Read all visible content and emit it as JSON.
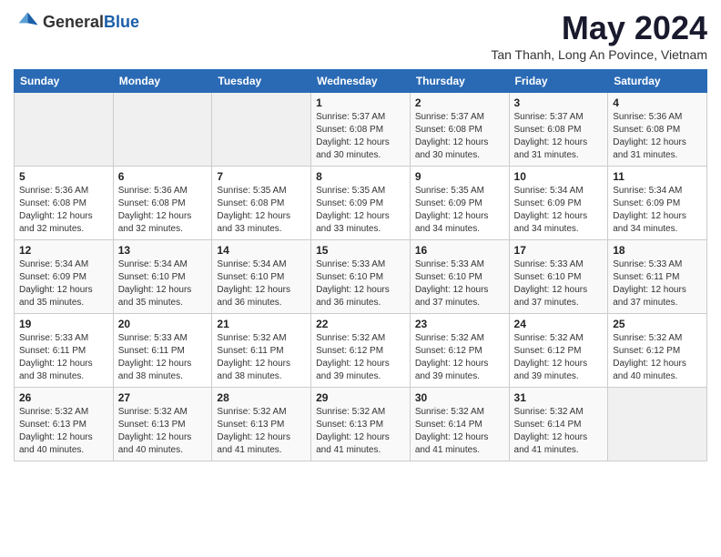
{
  "header": {
    "logo_general": "General",
    "logo_blue": "Blue",
    "main_title": "May 2024",
    "subtitle": "Tan Thanh, Long An Povince, Vietnam"
  },
  "calendar": {
    "weekdays": [
      "Sunday",
      "Monday",
      "Tuesday",
      "Wednesday",
      "Thursday",
      "Friday",
      "Saturday"
    ],
    "weeks": [
      [
        {
          "day": "",
          "sunrise": "",
          "sunset": "",
          "daylight": ""
        },
        {
          "day": "",
          "sunrise": "",
          "sunset": "",
          "daylight": ""
        },
        {
          "day": "",
          "sunrise": "",
          "sunset": "",
          "daylight": ""
        },
        {
          "day": "1",
          "sunrise": "Sunrise: 5:37 AM",
          "sunset": "Sunset: 6:08 PM",
          "daylight": "Daylight: 12 hours and 30 minutes."
        },
        {
          "day": "2",
          "sunrise": "Sunrise: 5:37 AM",
          "sunset": "Sunset: 6:08 PM",
          "daylight": "Daylight: 12 hours and 30 minutes."
        },
        {
          "day": "3",
          "sunrise": "Sunrise: 5:37 AM",
          "sunset": "Sunset: 6:08 PM",
          "daylight": "Daylight: 12 hours and 31 minutes."
        },
        {
          "day": "4",
          "sunrise": "Sunrise: 5:36 AM",
          "sunset": "Sunset: 6:08 PM",
          "daylight": "Daylight: 12 hours and 31 minutes."
        }
      ],
      [
        {
          "day": "5",
          "sunrise": "Sunrise: 5:36 AM",
          "sunset": "Sunset: 6:08 PM",
          "daylight": "Daylight: 12 hours and 32 minutes."
        },
        {
          "day": "6",
          "sunrise": "Sunrise: 5:36 AM",
          "sunset": "Sunset: 6:08 PM",
          "daylight": "Daylight: 12 hours and 32 minutes."
        },
        {
          "day": "7",
          "sunrise": "Sunrise: 5:35 AM",
          "sunset": "Sunset: 6:08 PM",
          "daylight": "Daylight: 12 hours and 33 minutes."
        },
        {
          "day": "8",
          "sunrise": "Sunrise: 5:35 AM",
          "sunset": "Sunset: 6:09 PM",
          "daylight": "Daylight: 12 hours and 33 minutes."
        },
        {
          "day": "9",
          "sunrise": "Sunrise: 5:35 AM",
          "sunset": "Sunset: 6:09 PM",
          "daylight": "Daylight: 12 hours and 34 minutes."
        },
        {
          "day": "10",
          "sunrise": "Sunrise: 5:34 AM",
          "sunset": "Sunset: 6:09 PM",
          "daylight": "Daylight: 12 hours and 34 minutes."
        },
        {
          "day": "11",
          "sunrise": "Sunrise: 5:34 AM",
          "sunset": "Sunset: 6:09 PM",
          "daylight": "Daylight: 12 hours and 34 minutes."
        }
      ],
      [
        {
          "day": "12",
          "sunrise": "Sunrise: 5:34 AM",
          "sunset": "Sunset: 6:09 PM",
          "daylight": "Daylight: 12 hours and 35 minutes."
        },
        {
          "day": "13",
          "sunrise": "Sunrise: 5:34 AM",
          "sunset": "Sunset: 6:10 PM",
          "daylight": "Daylight: 12 hours and 35 minutes."
        },
        {
          "day": "14",
          "sunrise": "Sunrise: 5:34 AM",
          "sunset": "Sunset: 6:10 PM",
          "daylight": "Daylight: 12 hours and 36 minutes."
        },
        {
          "day": "15",
          "sunrise": "Sunrise: 5:33 AM",
          "sunset": "Sunset: 6:10 PM",
          "daylight": "Daylight: 12 hours and 36 minutes."
        },
        {
          "day": "16",
          "sunrise": "Sunrise: 5:33 AM",
          "sunset": "Sunset: 6:10 PM",
          "daylight": "Daylight: 12 hours and 37 minutes."
        },
        {
          "day": "17",
          "sunrise": "Sunrise: 5:33 AM",
          "sunset": "Sunset: 6:10 PM",
          "daylight": "Daylight: 12 hours and 37 minutes."
        },
        {
          "day": "18",
          "sunrise": "Sunrise: 5:33 AM",
          "sunset": "Sunset: 6:11 PM",
          "daylight": "Daylight: 12 hours and 37 minutes."
        }
      ],
      [
        {
          "day": "19",
          "sunrise": "Sunrise: 5:33 AM",
          "sunset": "Sunset: 6:11 PM",
          "daylight": "Daylight: 12 hours and 38 minutes."
        },
        {
          "day": "20",
          "sunrise": "Sunrise: 5:33 AM",
          "sunset": "Sunset: 6:11 PM",
          "daylight": "Daylight: 12 hours and 38 minutes."
        },
        {
          "day": "21",
          "sunrise": "Sunrise: 5:32 AM",
          "sunset": "Sunset: 6:11 PM",
          "daylight": "Daylight: 12 hours and 38 minutes."
        },
        {
          "day": "22",
          "sunrise": "Sunrise: 5:32 AM",
          "sunset": "Sunset: 6:12 PM",
          "daylight": "Daylight: 12 hours and 39 minutes."
        },
        {
          "day": "23",
          "sunrise": "Sunrise: 5:32 AM",
          "sunset": "Sunset: 6:12 PM",
          "daylight": "Daylight: 12 hours and 39 minutes."
        },
        {
          "day": "24",
          "sunrise": "Sunrise: 5:32 AM",
          "sunset": "Sunset: 6:12 PM",
          "daylight": "Daylight: 12 hours and 39 minutes."
        },
        {
          "day": "25",
          "sunrise": "Sunrise: 5:32 AM",
          "sunset": "Sunset: 6:12 PM",
          "daylight": "Daylight: 12 hours and 40 minutes."
        }
      ],
      [
        {
          "day": "26",
          "sunrise": "Sunrise: 5:32 AM",
          "sunset": "Sunset: 6:13 PM",
          "daylight": "Daylight: 12 hours and 40 minutes."
        },
        {
          "day": "27",
          "sunrise": "Sunrise: 5:32 AM",
          "sunset": "Sunset: 6:13 PM",
          "daylight": "Daylight: 12 hours and 40 minutes."
        },
        {
          "day": "28",
          "sunrise": "Sunrise: 5:32 AM",
          "sunset": "Sunset: 6:13 PM",
          "daylight": "Daylight: 12 hours and 41 minutes."
        },
        {
          "day": "29",
          "sunrise": "Sunrise: 5:32 AM",
          "sunset": "Sunset: 6:13 PM",
          "daylight": "Daylight: 12 hours and 41 minutes."
        },
        {
          "day": "30",
          "sunrise": "Sunrise: 5:32 AM",
          "sunset": "Sunset: 6:14 PM",
          "daylight": "Daylight: 12 hours and 41 minutes."
        },
        {
          "day": "31",
          "sunrise": "Sunrise: 5:32 AM",
          "sunset": "Sunset: 6:14 PM",
          "daylight": "Daylight: 12 hours and 41 minutes."
        },
        {
          "day": "",
          "sunrise": "",
          "sunset": "",
          "daylight": ""
        }
      ]
    ]
  }
}
